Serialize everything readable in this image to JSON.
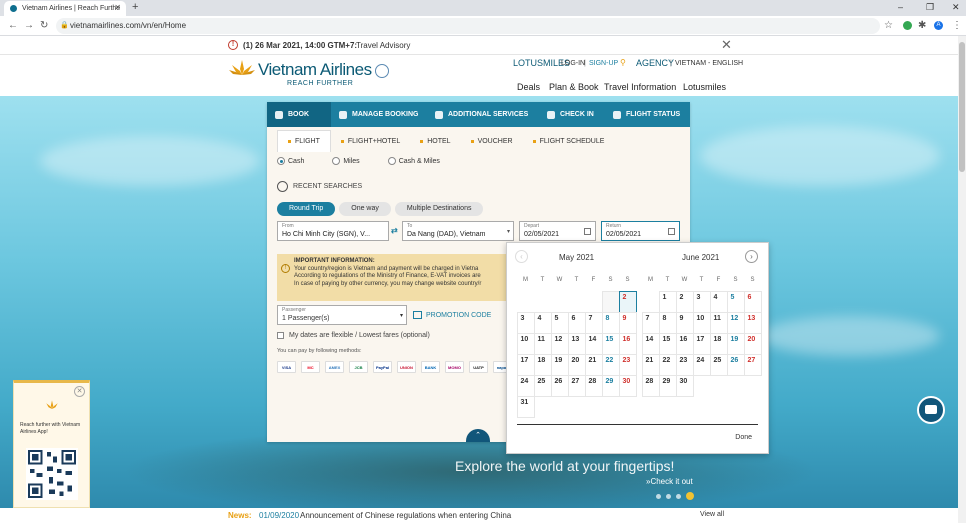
{
  "browser": {
    "tab_title": "Vietnam Airlines | Reach Furthe",
    "url": "vietnamairlines.com/vn/en/Home",
    "new_tab": "+",
    "profile_initial": "A"
  },
  "advisory": {
    "date": "(1) 26 Mar 2021, 14:00 GTM+7:",
    "link": "Travel Advisory"
  },
  "header": {
    "logo_name": "Vietnam Airlines",
    "logo_tagline": "REACH FURTHER",
    "lotusmiles": "LOTUSMILES",
    "login": "LOG-IN",
    "signup": "SIGN-UP",
    "agency": "AGENCY",
    "locale": "VIETNAM - ENGLISH",
    "nav": [
      "Deals",
      "Plan & Book",
      "Travel Information",
      "Lotusmiles"
    ]
  },
  "widget": {
    "tabs": [
      "BOOK",
      "MANAGE BOOKING",
      "ADDITIONAL SERVICES",
      "CHECK IN",
      "FLIGHT STATUS"
    ],
    "subtabs": [
      "FLIGHT",
      "FLIGHT+HOTEL",
      "HOTEL",
      "VOUCHER",
      "FLIGHT SCHEDULE"
    ],
    "payment_options": [
      "Cash",
      "Miles",
      "Cash & Miles"
    ],
    "recent_searches": "RECENT SEARCHES",
    "trip_types": [
      "Round Trip",
      "One way",
      "Multiple Destinations"
    ],
    "from_label": "From",
    "from_value": "Ho Chi Minh City (SGN), V...",
    "to_label": "To",
    "to_value": "Da Nang (DAD), Vietnam",
    "depart_label": "Depart",
    "depart_value": "02/05/2021",
    "return_label": "Return",
    "return_value": "02/05/2021",
    "notice_title": "IMPORTANT INFORMATION:",
    "notice_line1": "Your country/region is Vietnam and payment will be charged in Vietna",
    "notice_line2": "According to regulations of the Ministry of Finance, E-VAT invoices are",
    "notice_line3": "In case of paying by other currency, you may change website country/r",
    "passenger_label": "Passenger",
    "passenger_value": "1 Passenger(s)",
    "promo": "PROMOTION CODE",
    "flexible": "My dates are flexible / Lowest fares (optional)",
    "pay_methods_label": "You can pay by following methods:",
    "cards": [
      "VISA",
      "MC",
      "AMEX",
      "JCB",
      "PayPal",
      "UNION",
      "BANK",
      "MOMO",
      "UATP",
      "napas"
    ]
  },
  "calendar": {
    "months": [
      {
        "name": "May 2021",
        "lead_blanks": 5,
        "days": 31,
        "past_until": 1,
        "selected": 2
      },
      {
        "name": "June 2021",
        "lead_blanks": 1,
        "days": 30,
        "past_until": 0,
        "selected": 0
      }
    ],
    "weekdays": [
      "M",
      "T",
      "W",
      "T",
      "F",
      "S",
      "S"
    ],
    "done": "Done"
  },
  "app_promo": {
    "text": "Reach further with Vietnam Airlines App!"
  },
  "hero": {
    "headline": "Explore the world at your fingertips!",
    "cta": "»Check it out"
  },
  "news": {
    "label": "News:",
    "date": "01/09/2020",
    "text": "Announcement of Chinese regulations when entering China",
    "view_all": "View all"
  }
}
